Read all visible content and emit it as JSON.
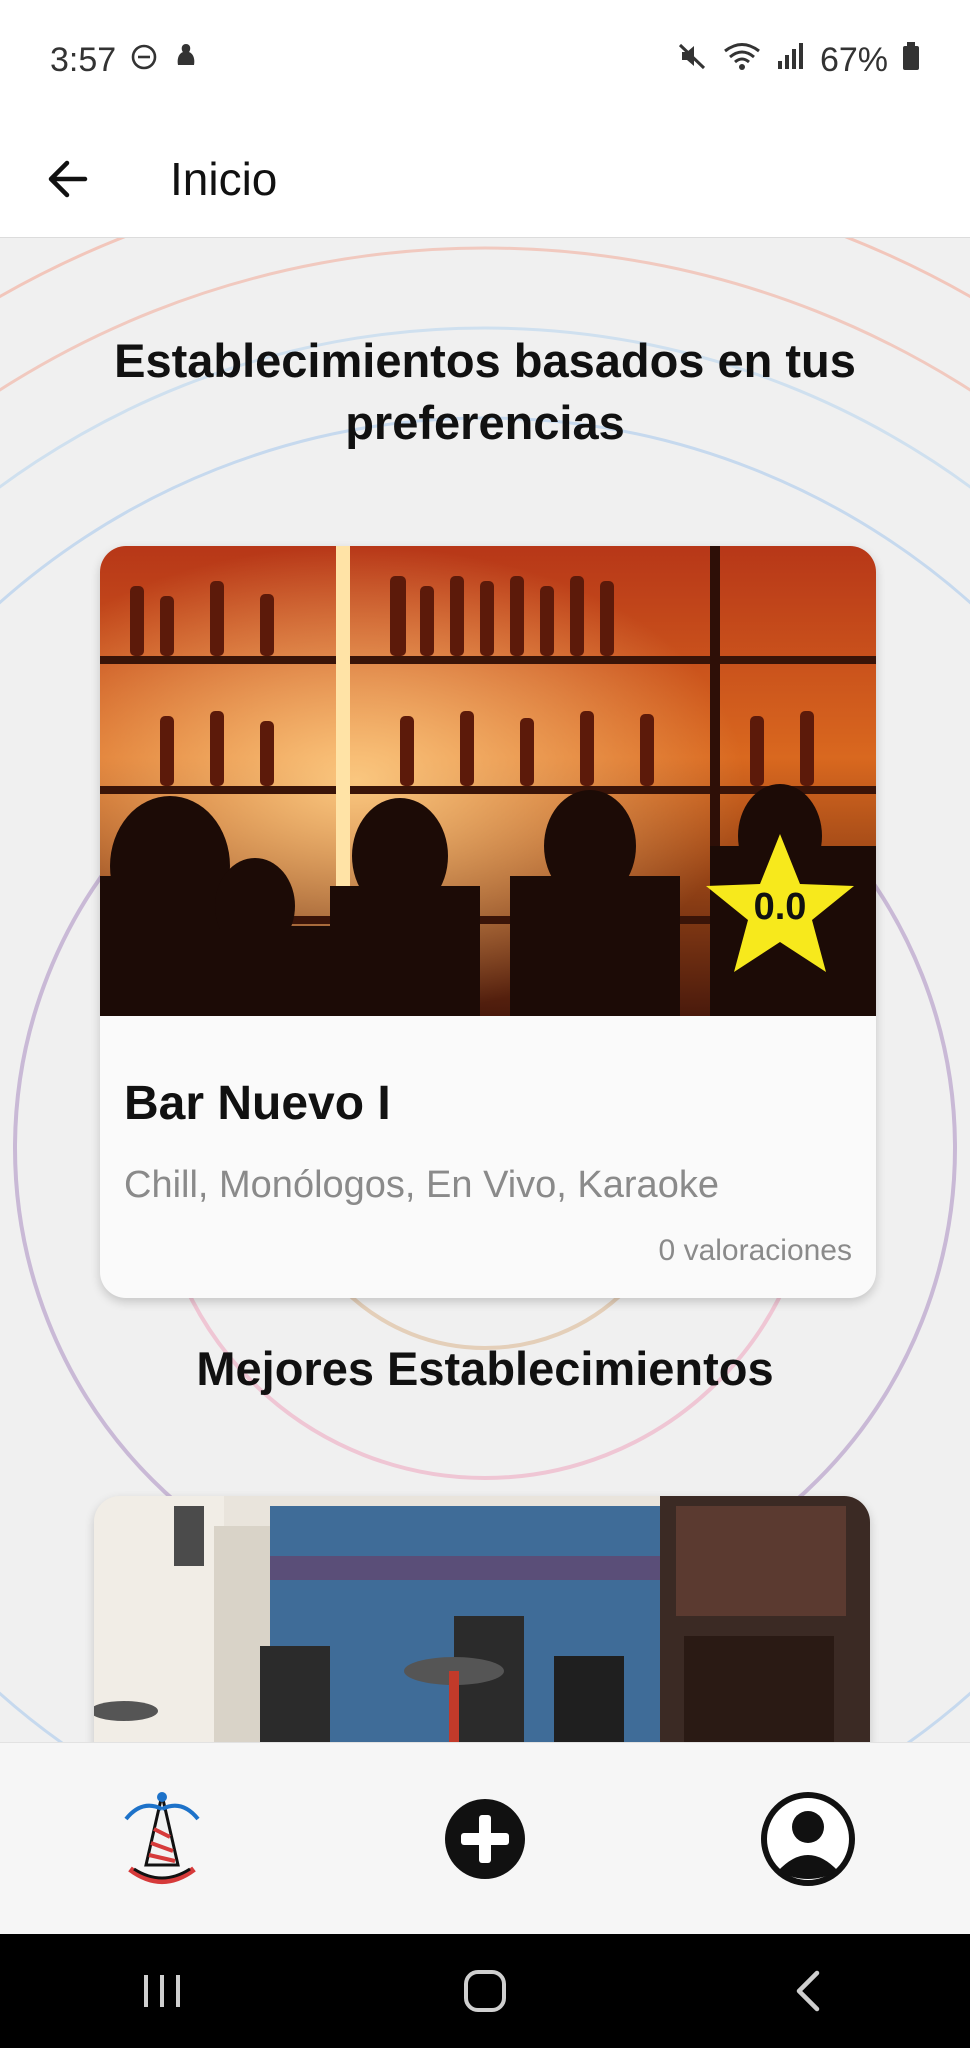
{
  "status_bar": {
    "time": "3:57",
    "battery": "67%",
    "icons": [
      "do-not-disturb-icon",
      "notification-icon",
      "mute-icon",
      "wifi-icon",
      "signal-icon",
      "battery-icon"
    ]
  },
  "appbar": {
    "back_icon": "arrow-left-icon",
    "title": "Inicio"
  },
  "sections": {
    "preferences_title": "Establecimientos basados en tus preferencias",
    "best_title": "Mejores Establecimientos"
  },
  "featured_card": {
    "name": "Bar Nuevo I",
    "tags": "Chill, Monólogos, En Vivo, Karaoke",
    "rating": "0.0",
    "reviews": "0 valoraciones",
    "image": "bar-interior-photo"
  },
  "best_card": {
    "image": "street-bar-facade-photo"
  },
  "bottom_nav": {
    "items": [
      {
        "icon": "party-hat-icon"
      },
      {
        "icon": "add-circle-icon"
      },
      {
        "icon": "profile-icon"
      }
    ]
  },
  "system_nav": {
    "items": [
      "recents-icon",
      "home-icon",
      "back-icon"
    ]
  },
  "colors": {
    "accent_star": "#f7e91c",
    "background": "#f0f0f0"
  }
}
